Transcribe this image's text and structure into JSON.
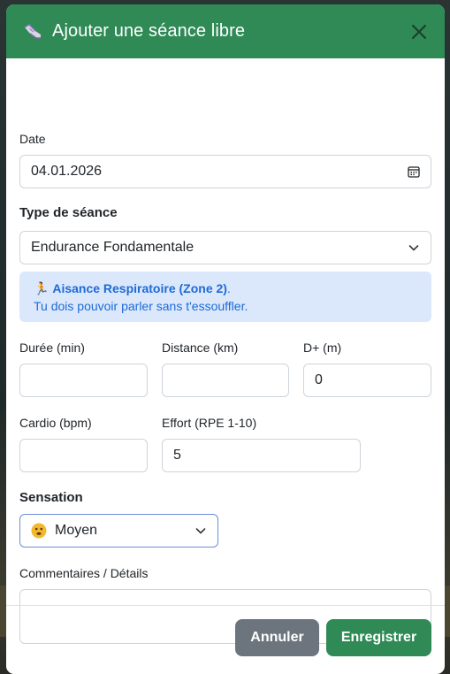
{
  "modal": {
    "title": "Ajouter une séance libre",
    "header_color": "#2f8a56"
  },
  "form": {
    "date": {
      "label": "Date",
      "value": "04.01.2026"
    },
    "session_type": {
      "label": "Type de séance",
      "value": "Endurance Fondamentale"
    },
    "info": {
      "icon": "🏃",
      "zone_text": "Aisance Respiratoire (Zone 2)",
      "zone_suffix": ".",
      "detail": "Tu dois pouvoir parler sans t'essouffler."
    },
    "duration": {
      "label": "Durée (min)",
      "value": ""
    },
    "distance": {
      "label": "Distance (km)",
      "value": ""
    },
    "elevation": {
      "label": "D+ (m)",
      "value": "0"
    },
    "heart_rate": {
      "label": "Cardio (bpm)",
      "value": ""
    },
    "effort": {
      "label": "Effort (RPE 1-10)",
      "value": "5"
    },
    "feeling": {
      "label": "Sensation",
      "value": "Moyen",
      "emoji": "neutral-face"
    },
    "comments": {
      "label": "Commentaires / Détails",
      "value": ""
    }
  },
  "footer": {
    "cancel_label": "Annuler",
    "save_label": "Enregistrer",
    "cancel_color": "#6c757d",
    "save_color": "#2f8a56"
  }
}
